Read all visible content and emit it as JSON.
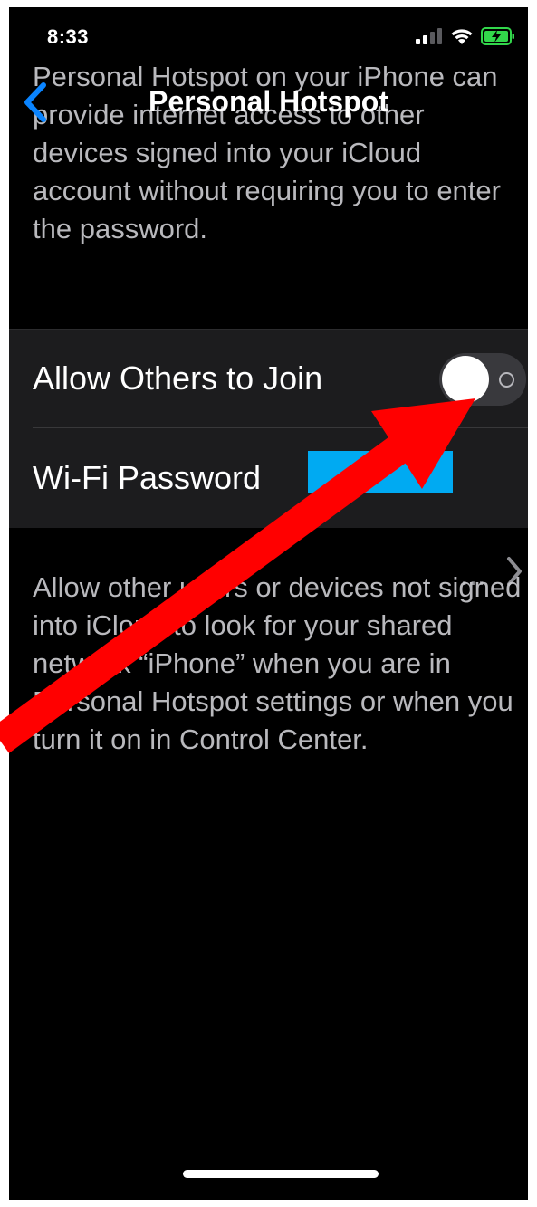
{
  "status_bar": {
    "time": "8:33",
    "icons": [
      "cellular-signal-icon",
      "wifi-icon",
      "battery-charging-icon"
    ]
  },
  "nav": {
    "back_icon": "chevron-left-icon",
    "title": "Personal Hotspot"
  },
  "top_description": "Personal Hotspot on your iPhone can provide internet access to other devices signed into your iCloud account without requiring you to enter the password.",
  "settings": {
    "allow_others": {
      "label": "Allow Others to Join",
      "enabled": false
    },
    "wifi_password": {
      "label": "Wi-Fi Password",
      "value_suffix": "...",
      "chevron_icon": "chevron-right-icon"
    }
  },
  "bottom_description": "Allow other users or devices not signed into iCloud to look for your shared network “iPhone” when you are in Personal Hotspot settings or when you turn it on in Control Center.",
  "colors": {
    "background": "#000000",
    "cell_background": "#1c1c1e",
    "accent_blue": "#0a84ff",
    "toggle_off_track": "#39393d",
    "annotation_red": "#ff0000",
    "redaction_blue": "#00aaf2"
  }
}
